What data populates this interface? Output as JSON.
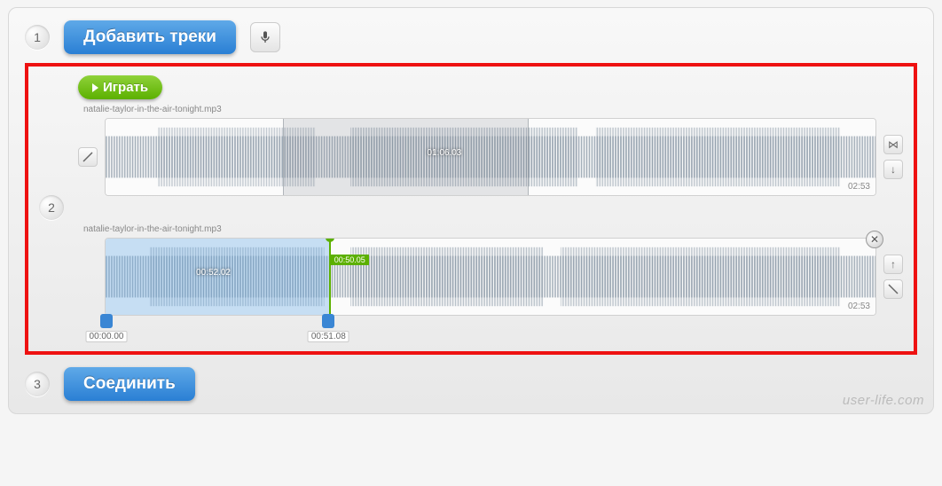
{
  "step1": {
    "num": "1",
    "add_label": "Добавить треки"
  },
  "step2": {
    "num": "2",
    "play_label": "Играть"
  },
  "step3": {
    "num": "3",
    "join_label": "Соединить"
  },
  "tracks": [
    {
      "filename": "natalie-taylor-in-the-air-tonight.mp3",
      "duration": "02:53",
      "center_time": "01:06.03",
      "seg_start_pct": 23,
      "seg_end_pct": 55
    },
    {
      "filename": "natalie-taylor-in-the-air-tonight.mp3",
      "duration": "02:53",
      "center_time": "00:52.02",
      "sel_end_pct": 29,
      "playhead_label": "00:50.05",
      "handle_start": "00:00.00",
      "handle_end": "00:51.08"
    }
  ],
  "watermark": "user-life.com"
}
